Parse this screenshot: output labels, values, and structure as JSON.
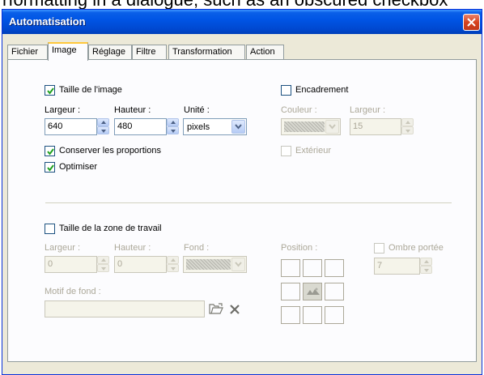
{
  "top_strip_text": "rformatting in a dialogue, such as an obscured checkbox",
  "window": {
    "title": "Automatisation"
  },
  "tabs": [
    {
      "label": "Fichier",
      "active": false
    },
    {
      "label": "Image",
      "active": true
    },
    {
      "label": "Réglage",
      "active": false
    },
    {
      "label": "Filtre",
      "active": false
    },
    {
      "label": "Transformation",
      "active": false
    },
    {
      "label": "Action",
      "active": false
    }
  ],
  "image_size": {
    "checkbox_label": "Taille de l'image",
    "checked": true,
    "width_label": "Largeur :",
    "width_value": "640",
    "height_label": "Hauteur :",
    "height_value": "480",
    "unit_label": "Unité :",
    "unit_value": "pixels",
    "keep_ratio_label": "Conserver les proportions",
    "keep_ratio_checked": true,
    "optimize_label": "Optimiser",
    "optimize_checked": true
  },
  "frame": {
    "checkbox_label": "Encadrement",
    "checked": false,
    "color_label": "Couleur :",
    "width_label": "Largeur :",
    "width_value": "15",
    "outside_label": "Extérieur",
    "outside_checked": false
  },
  "workspace": {
    "checkbox_label": "Taille de la zone de travail",
    "checked": false,
    "width_label": "Largeur :",
    "width_value": "0",
    "height_label": "Hauteur :",
    "height_value": "0",
    "background_label": "Fond :",
    "position_label": "Position :",
    "shadow_label": "Ombre portée",
    "shadow_checked": false,
    "shadow_value": "7",
    "pattern_label": "Motif de fond :",
    "pattern_value": ""
  },
  "colors": {
    "title_bar": "#0055e5",
    "close_button": "#d7431f",
    "window_bg": "#ece9d8",
    "check_mark": "#21a121"
  }
}
